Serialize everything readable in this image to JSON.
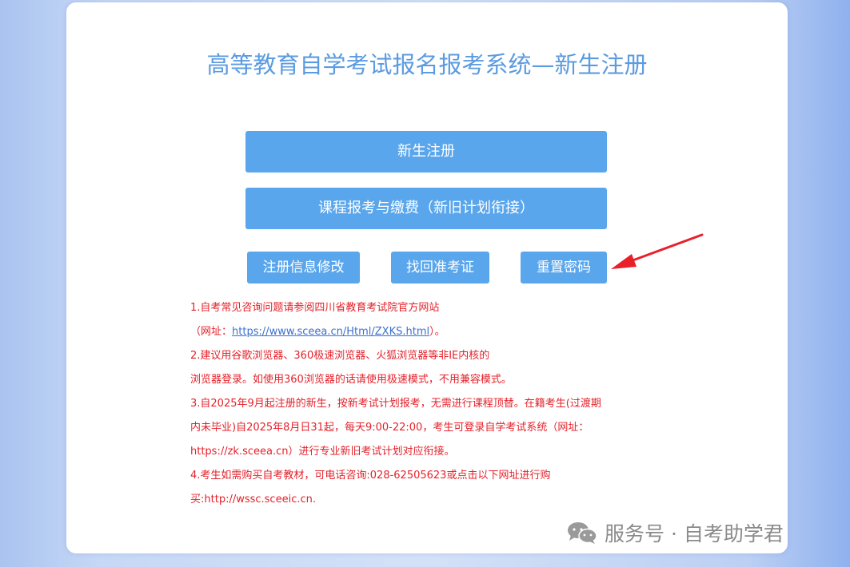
{
  "page": {
    "title": "高等教育自学考试报名报考系统—新生注册"
  },
  "buttons": {
    "register": "新生注册",
    "course": "课程报考与缴费（新旧计划衔接）",
    "modify": "注册信息修改",
    "ticket": "找回准考证",
    "reset": "重置密码"
  },
  "notices": {
    "n1_a": "1.自考常见咨询问题请参阅四川省教育考试院官方网站",
    "n1_b_prefix": "（网址：",
    "n1_link": "https://www.sceea.cn/Html/ZXKS.html",
    "n1_b_suffix": "）。",
    "n2_a": "2.建议用谷歌浏览器、360极速浏览器、火狐浏览器等非IE内核的",
    "n2_b": "浏览器登录。如使用360浏览器的话请使用极速模式，不用兼容模式。",
    "n3_a": "3.自2025年9月起注册的新生，按新考试计划报考，无需进行课程顶替。在籍考生(过渡期",
    "n3_b": "内未毕业)自2025年8月日31起，每天9:00-22:00，考生可登录自学考试系统（网址：",
    "n3_c": "https://zk.sceea.cn）进行专业新旧考试计划对应衔接。",
    "n4_a": "4.考生如需购买自考教材，可电话咨询:028-62505623或点击以下网址进行购",
    "n4_b": "买:http://wssc.sceeic.cn."
  },
  "watermark": {
    "text": "服务号 · 自考助学君"
  },
  "colors": {
    "button": "#5aa6ec",
    "title": "#5b9be0",
    "notice": "#e4212a",
    "arrow": "#e8202a"
  },
  "icons": {
    "arrow": "red-arrow-icon",
    "wechat": "wechat-icon"
  }
}
